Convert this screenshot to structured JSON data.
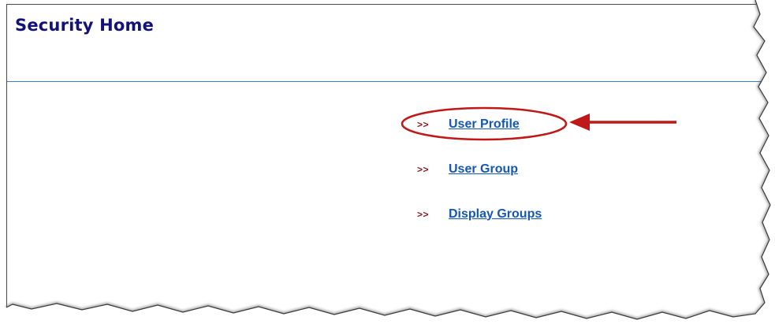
{
  "header": {
    "title": "Security Home"
  },
  "links": [
    {
      "bullet": ">>",
      "label": "User Profile"
    },
    {
      "bullet": ">>",
      "label": "User Group"
    },
    {
      "bullet": ">>",
      "label": "Display Groups"
    }
  ],
  "colors": {
    "title": "#12127a",
    "link": "#1557b4",
    "bullet": "#8f1a1a",
    "rule": "#3d7ad8",
    "annotation": "#c01818"
  },
  "icons": {
    "callout_arrow": "arrow-left-icon",
    "highlight": "ellipse-highlight"
  }
}
